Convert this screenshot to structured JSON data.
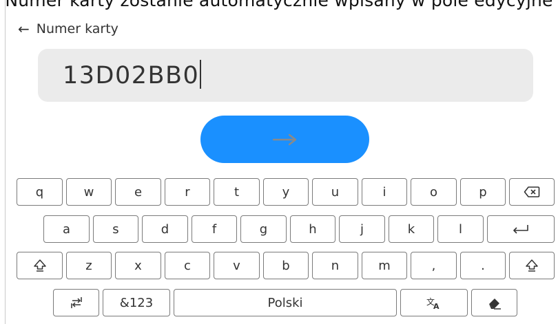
{
  "caption": "Numer karty zostanie automatycznie wpisany w pole edycyjne",
  "header": {
    "back_icon": "arrow-left-icon",
    "title": "Numer karty"
  },
  "field": {
    "value": "13D02BB0"
  },
  "submit": {
    "icon": "arrow-right-icon",
    "color": "#1a90ff"
  },
  "keyboard": {
    "row1": [
      "q",
      "w",
      "e",
      "r",
      "t",
      "y",
      "u",
      "i",
      "o",
      "p"
    ],
    "row2": [
      "a",
      "s",
      "d",
      "f",
      "g",
      "h",
      "j",
      "k",
      "l"
    ],
    "row3": [
      "z",
      "x",
      "c",
      "v",
      "b",
      "n",
      "m",
      ",",
      "."
    ],
    "symbols_label": "&123",
    "space_label": "Polski",
    "icons": {
      "backspace": "backspace-icon",
      "enter": "enter-icon",
      "shift": "shift-icon",
      "switch": "keyboard-switch-icon",
      "translate": "translate-icon",
      "eraser": "eraser-icon"
    }
  }
}
